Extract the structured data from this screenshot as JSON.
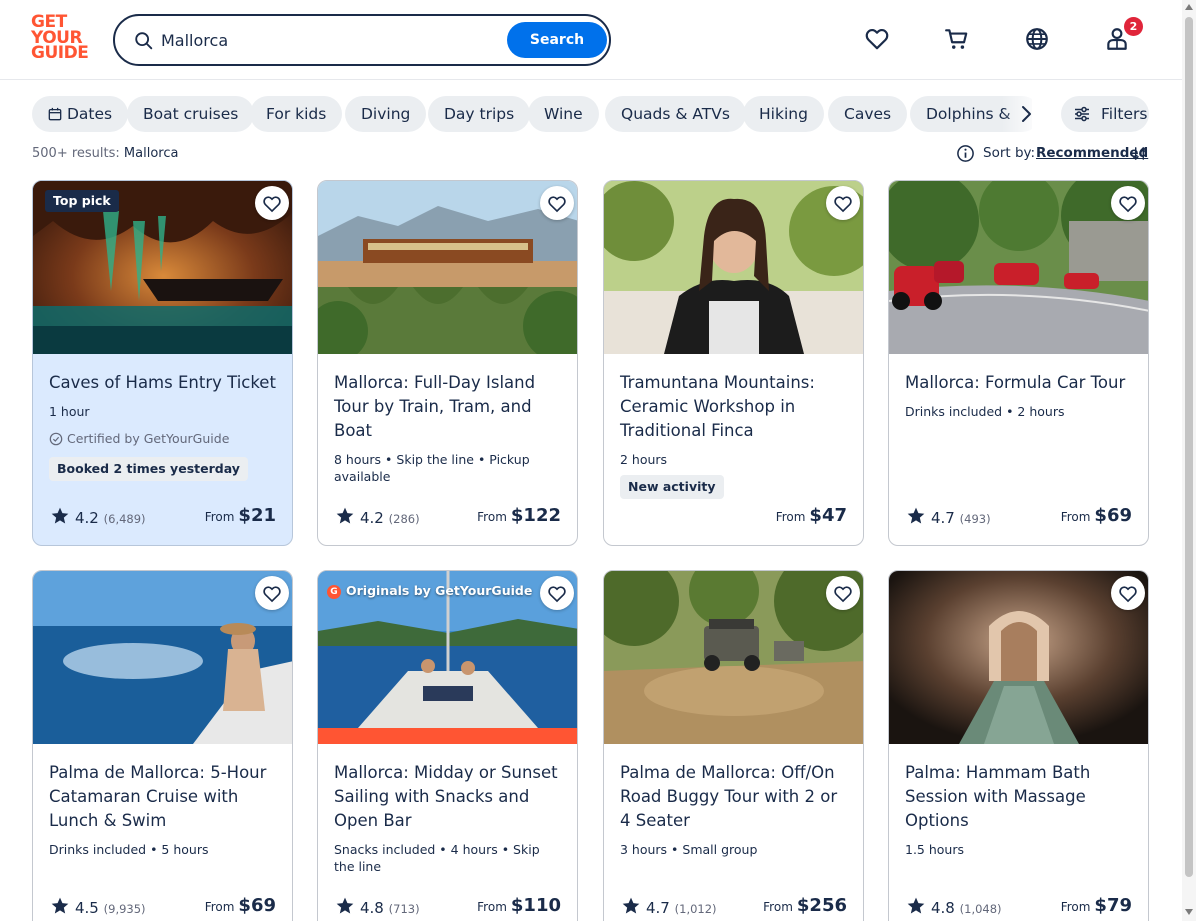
{
  "brand": {
    "logo_lines": [
      "GET",
      "YOUR",
      "GUIDE"
    ],
    "accent": "#ff5533",
    "primary": "#0071eb",
    "navy": "#1a2b49"
  },
  "search": {
    "value": "Mallorca",
    "button": "Search"
  },
  "header_icons": [
    "heart-icon",
    "cart-icon",
    "globe-icon",
    "profile-icon"
  ],
  "notifications": "2",
  "chips": [
    "Dates",
    "Boat cruises",
    "For kids",
    "Diving",
    "Day trips",
    "Wine",
    "Quads & ATVs",
    "Hiking",
    "Caves",
    "Dolphins &"
  ],
  "filters_label": "Filters",
  "results": {
    "count": "500+ results:",
    "query": "Mallorca"
  },
  "sort": {
    "label": "Sort by:",
    "value": "Recommended"
  },
  "price_prefix": "From",
  "cards": [
    {
      "badge": "Top pick",
      "title": "Caves of Hams Entry Ticket",
      "meta": "1 hour",
      "certified": "Certified by GetYourGuide",
      "tag": "Booked 2 times yesterday",
      "rating": "4.2",
      "reviews": "(6,489)",
      "price": "$21"
    },
    {
      "title": "Mallorca: Full-Day Island Tour by Train, Tram, and Boat",
      "meta": "8 hours • Skip the line • Pickup available",
      "rating": "4.2",
      "reviews": "(286)",
      "price": "$122"
    },
    {
      "title": "Tramuntana Mountains: Ceramic Workshop in Traditional Finca",
      "meta": "2 hours",
      "tag": "New activity",
      "price": "$47"
    },
    {
      "title": "Mallorca: Formula Car Tour",
      "meta": "Drinks included • 2 hours",
      "rating": "4.7",
      "reviews": "(493)",
      "price": "$69"
    },
    {
      "title": "Palma de Mallorca: 5-Hour Catamaran Cruise with Lunch & Swim",
      "meta": "Drinks included • 5 hours",
      "rating": "4.5",
      "reviews": "(9,935)",
      "price": "$69"
    },
    {
      "badge": "Originals by GetYourGuide",
      "title": "Mallorca: Midday or Sunset Sailing with Snacks and Open Bar",
      "meta": "Snacks included • 4 hours • Skip the line",
      "rating": "4.8",
      "reviews": "(713)",
      "price": "$110"
    },
    {
      "title": "Palma de Mallorca: Off/On Road Buggy Tour with 2 or 4 Seater",
      "meta": "3 hours • Small group",
      "rating": "4.7",
      "reviews": "(1,012)",
      "price": "$256"
    },
    {
      "title": "Palma: Hammam Bath Session with Massage Options",
      "meta": "1.5 hours",
      "rating": "4.8",
      "reviews": "(1,048)",
      "price": "$79"
    }
  ]
}
